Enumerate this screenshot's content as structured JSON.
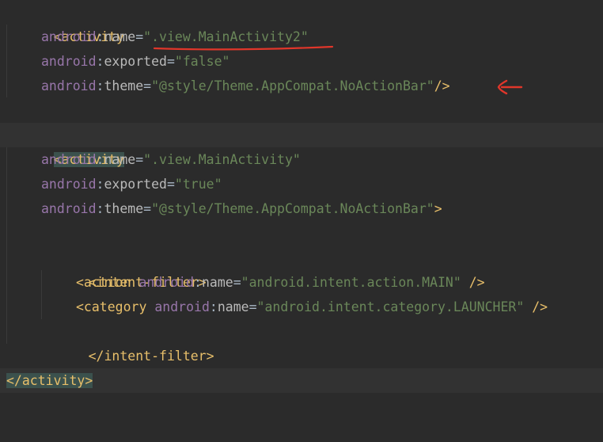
{
  "editor": {
    "colors": {
      "background": "#2b2b2b",
      "tag": "#e8bf6a",
      "namespace": "#9876aa",
      "attribute": "#bababa",
      "string": "#6a8759",
      "tag_highlight": "#3b514d",
      "annotation": "#e0362a"
    },
    "annotation_icon": "red-arrow-left-icon",
    "lines": [
      {
        "tag": "<activity"
      },
      {
        "ns": "android",
        "attr": "name",
        "value": "\".view.MainActivity2\""
      },
      {
        "ns": "android",
        "attr": "exported",
        "value": "\"false\""
      },
      {
        "ns": "android",
        "attr": "theme",
        "value": "\"@style/Theme.AppCompat.NoActionBar\"",
        "end": "/>"
      },
      {},
      {
        "tag": "<activity"
      },
      {
        "ns": "android",
        "attr": "name",
        "value": "\".view.MainActivity\""
      },
      {
        "ns": "android",
        "attr": "exported",
        "value": "\"true\""
      },
      {
        "ns": "android",
        "attr": "theme",
        "value": "\"@style/Theme.AppCompat.NoActionBar\"",
        "end": ">"
      },
      {},
      {
        "tag": "<intent-filter>"
      },
      {
        "tag": "<action",
        "ns": "android",
        "attr": "name",
        "value": "\"android.intent.action.MAIN\"",
        "end": " />"
      },
      {
        "tag": "<category",
        "ns": "android",
        "attr": "name",
        "value": "\"android.intent.category.LAUNCHER\"",
        "end": " />"
      },
      {
        "tag": "</intent-filter>"
      },
      {},
      {
        "tag": "</activity",
        "end": ">"
      }
    ]
  }
}
